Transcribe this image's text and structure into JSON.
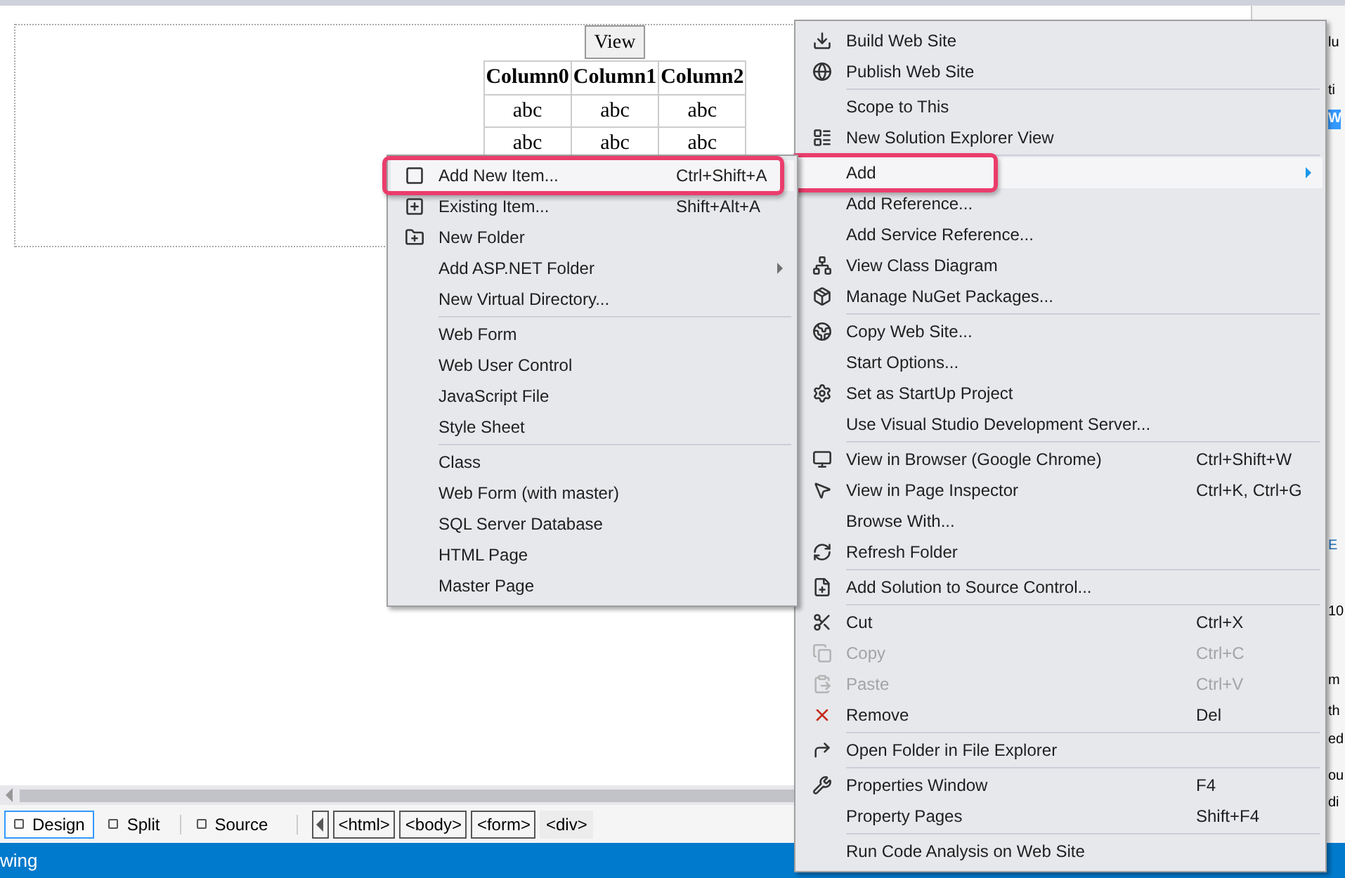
{
  "design_surface": {
    "button": "View",
    "table": {
      "columns": [
        "Column0",
        "Column1",
        "Column2"
      ],
      "rows": [
        [
          "abc",
          "abc",
          "abc"
        ],
        [
          "abc",
          "abc",
          "abc"
        ]
      ]
    }
  },
  "view_tabs": [
    {
      "label": "Design",
      "selected": true
    },
    {
      "label": "Split",
      "selected": false
    },
    {
      "label": "Source",
      "selected": false
    }
  ],
  "breadcrumb": [
    {
      "label": "<html>",
      "selected": false
    },
    {
      "label": "<body>",
      "selected": false
    },
    {
      "label": "<form>",
      "selected": false
    },
    {
      "label": "<div>",
      "selected": true
    }
  ],
  "status_bar": "wing",
  "side_panel": [
    "lu",
    "ti",
    "W",
    "E",
    "10",
    "m",
    "th",
    "ed",
    "ou",
    "di"
  ],
  "context_menu": {
    "groups": [
      [
        {
          "label": "Build Web Site",
          "selected": false,
          "disabled": false,
          "submenu": false
        },
        {
          "label": "Publish Web Site",
          "selected": false,
          "disabled": false,
          "submenu": false
        }
      ],
      [
        {
          "label": "Scope to This",
          "selected": false,
          "disabled": false,
          "submenu": false
        },
        {
          "label": "New Solution Explorer View",
          "selected": false,
          "disabled": false,
          "submenu": false
        }
      ],
      [
        {
          "label": "Add",
          "selected": true,
          "disabled": false,
          "submenu": true
        },
        {
          "label": "Add Reference...",
          "selected": false,
          "disabled": false,
          "submenu": false
        },
        {
          "label": "Add Service Reference...",
          "selected": false,
          "disabled": false,
          "submenu": false
        },
        {
          "label": "View Class Diagram",
          "selected": false,
          "disabled": false,
          "submenu": false
        },
        {
          "label": "Manage NuGet Packages...",
          "selected": false,
          "disabled": false,
          "submenu": false
        }
      ],
      [
        {
          "label": "Copy Web Site...",
          "selected": false,
          "disabled": false,
          "submenu": false
        },
        {
          "label": "Start Options...",
          "selected": false,
          "disabled": false,
          "submenu": false
        },
        {
          "label": "Set as StartUp Project",
          "selected": false,
          "disabled": false,
          "submenu": false
        },
        {
          "label": "Use Visual Studio Development Server...",
          "selected": false,
          "disabled": false,
          "submenu": false
        }
      ],
      [
        {
          "label": "View in Browser (Google Chrome)",
          "shortcut": "Ctrl+Shift+W",
          "selected": false,
          "disabled": false,
          "submenu": false
        },
        {
          "label": "View in Page Inspector",
          "shortcut": "Ctrl+K, Ctrl+G",
          "selected": false,
          "disabled": false,
          "submenu": false
        },
        {
          "label": "Browse With...",
          "selected": false,
          "disabled": false,
          "submenu": false
        },
        {
          "label": "Refresh Folder",
          "selected": false,
          "disabled": false,
          "submenu": false
        }
      ],
      [
        {
          "label": "Add Solution to Source Control...",
          "selected": false,
          "disabled": false,
          "submenu": false
        }
      ],
      [
        {
          "label": "Cut",
          "shortcut": "Ctrl+X",
          "selected": false,
          "disabled": false,
          "submenu": false
        },
        {
          "label": "Copy",
          "shortcut": "Ctrl+C",
          "selected": false,
          "disabled": true,
          "submenu": false
        },
        {
          "label": "Paste",
          "shortcut": "Ctrl+V",
          "selected": false,
          "disabled": true,
          "submenu": false
        },
        {
          "label": "Remove",
          "shortcut": "Del",
          "selected": false,
          "disabled": false,
          "submenu": false
        }
      ],
      [
        {
          "label": "Open Folder in File Explorer",
          "selected": false,
          "disabled": false,
          "submenu": false
        }
      ],
      [
        {
          "label": "Properties Window",
          "shortcut": "F4",
          "selected": false,
          "disabled": false,
          "submenu": false
        },
        {
          "label": "Property Pages",
          "shortcut": "Shift+F4",
          "selected": false,
          "disabled": false,
          "submenu": false
        }
      ],
      [
        {
          "label": "Run Code Analysis on Web Site",
          "selected": false,
          "disabled": false,
          "submenu": false
        }
      ]
    ]
  },
  "add_submenu": {
    "groups": [
      [
        {
          "label": "Add New Item...",
          "shortcut": "Ctrl+Shift+A",
          "selected": true,
          "disabled": false,
          "submenu": false
        },
        {
          "label": "Existing Item...",
          "shortcut": "Shift+Alt+A",
          "selected": false,
          "disabled": false,
          "submenu": false
        },
        {
          "label": "New Folder",
          "selected": false,
          "disabled": false,
          "submenu": false
        },
        {
          "label": "Add ASP.NET Folder",
          "selected": false,
          "disabled": false,
          "submenu": true
        },
        {
          "label": "New Virtual Directory...",
          "selected": false,
          "disabled": false,
          "submenu": false
        }
      ],
      [
        {
          "label": "Web Form",
          "selected": false,
          "disabled": false,
          "submenu": false
        },
        {
          "label": "Web User Control",
          "selected": false,
          "disabled": false,
          "submenu": false
        },
        {
          "label": "JavaScript File",
          "selected": false,
          "disabled": false,
          "submenu": false
        },
        {
          "label": "Style Sheet",
          "selected": false,
          "disabled": false,
          "submenu": false
        }
      ],
      [
        {
          "label": "Class",
          "selected": false,
          "disabled": false,
          "submenu": false
        },
        {
          "label": "Web Form (with master)",
          "selected": false,
          "disabled": false,
          "submenu": false
        },
        {
          "label": "SQL Server Database",
          "selected": false,
          "disabled": false,
          "submenu": false
        },
        {
          "label": "HTML Page",
          "selected": false,
          "disabled": false,
          "submenu": false
        },
        {
          "label": "Master Page",
          "selected": false,
          "disabled": false,
          "submenu": false
        }
      ]
    ]
  }
}
